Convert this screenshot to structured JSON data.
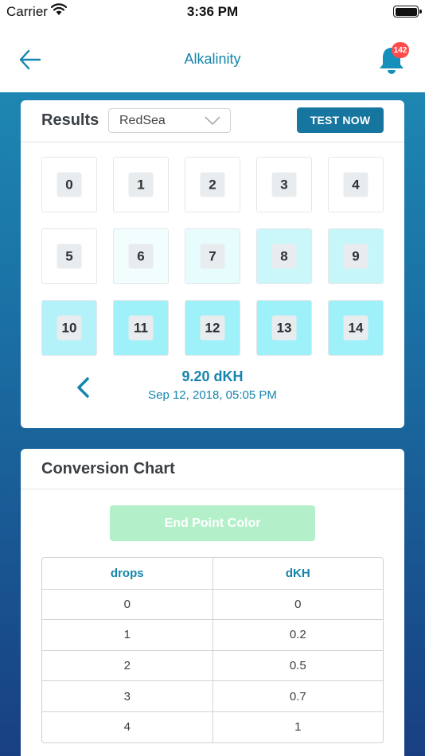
{
  "status_bar": {
    "carrier": "Carrier",
    "time": "3:36 PM"
  },
  "nav": {
    "title": "Alkalinity",
    "notification_count": "142"
  },
  "results": {
    "title": "Results",
    "brand_select": "RedSea",
    "test_button": "TEST NOW",
    "tiles": [
      {
        "label": "0",
        "color": "#ffffff"
      },
      {
        "label": "1",
        "color": "#ffffff"
      },
      {
        "label": "2",
        "color": "#ffffff"
      },
      {
        "label": "3",
        "color": "#ffffff"
      },
      {
        "label": "4",
        "color": "#ffffff"
      },
      {
        "label": "5",
        "color": "#ffffff"
      },
      {
        "label": "6",
        "color": "#f2fefe"
      },
      {
        "label": "7",
        "color": "#e6fcfd"
      },
      {
        "label": "8",
        "color": "#ccf7fa"
      },
      {
        "label": "9",
        "color": "#c6f6fa"
      },
      {
        "label": "10",
        "color": "#b2f2f8"
      },
      {
        "label": "11",
        "color": "#9ff1f9"
      },
      {
        "label": "12",
        "color": "#9ff1f9"
      },
      {
        "label": "13",
        "color": "#9ff1f9"
      },
      {
        "label": "14",
        "color": "#9ff1f9"
      }
    ],
    "reading_value": "9.20 dKH",
    "reading_date": "Sep 12, 2018, 05:05 PM"
  },
  "conversion": {
    "title": "Conversion Chart",
    "endpoint_button": "End Point Color",
    "columns": [
      "drops",
      "dKH"
    ],
    "rows": [
      [
        "0",
        "0"
      ],
      [
        "1",
        "0.2"
      ],
      [
        "2",
        "0.5"
      ],
      [
        "3",
        "0.7"
      ],
      [
        "4",
        "1"
      ]
    ]
  },
  "colors": {
    "accent": "#1585ad",
    "button": "#17769f",
    "badge": "#ff4d4f"
  }
}
